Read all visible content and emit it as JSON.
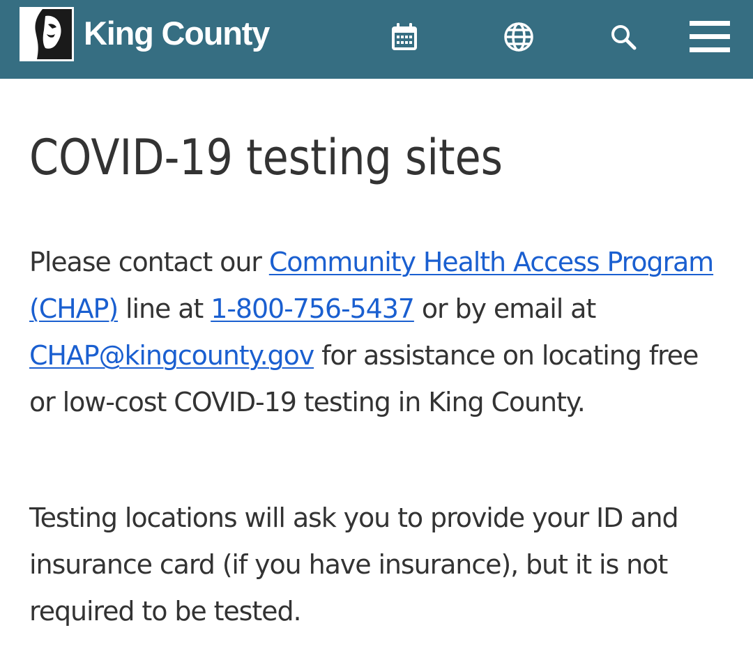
{
  "header": {
    "brand_name": "King County",
    "icons": {
      "calendar": "calendar-icon",
      "globe": "globe-icon",
      "search": "search-icon",
      "menu": "hamburger-menu-icon"
    },
    "colors": {
      "header_bg": "#366e82",
      "link": "#1a5fd0",
      "text": "#333333"
    }
  },
  "main": {
    "title": "COVID-19 testing sites",
    "para1": {
      "t1": "Please contact our ",
      "link_chap": "Community Health Access Program (CHAP)",
      "t2": " line at ",
      "link_phone": "1-800-756-5437",
      "t3": " or by email at ",
      "link_email": "CHAP@kingcounty.gov",
      "t4": " for assistance on locating free or low-cost COVID-19 testing in King County."
    },
    "para2": "Testing locations will ask you to provide your ID and insurance card (if you have insurance), but it is not required to be tested."
  }
}
